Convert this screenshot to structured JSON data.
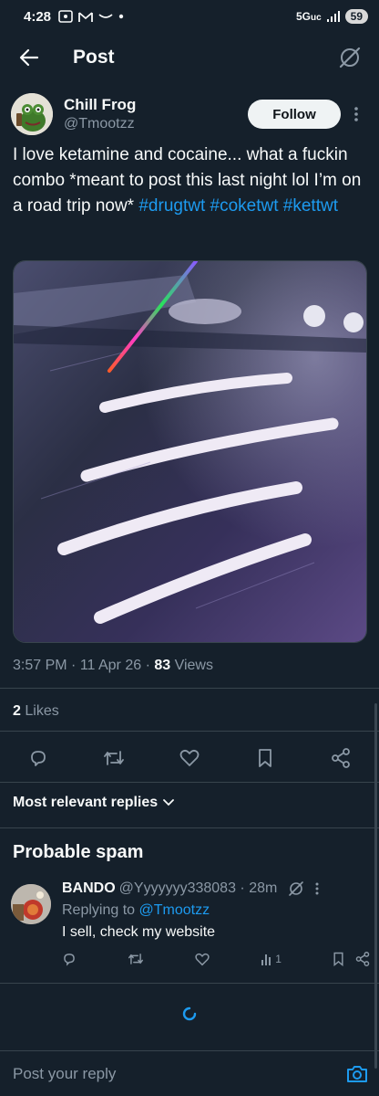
{
  "status_bar": {
    "time": "4:28",
    "network": "5G",
    "network_sub": "uc",
    "battery": "59"
  },
  "header": {
    "title": "Post"
  },
  "author": {
    "name": "Chill Frog",
    "handle": "@Tmootzz",
    "follow_label": "Follow"
  },
  "tweet": {
    "text": "I love ketamine and cocaine... what a fuckin combo *meant to post this last night lol I’m on a road trip now* ",
    "hashtags": [
      "#drugtwt",
      "#coketwt",
      "#kettwt"
    ],
    "time": "3:57 PM",
    "date": "11 Apr 26",
    "views_count": "83",
    "views_label": "Views",
    "likes_count": "2",
    "likes_label": "Likes"
  },
  "actions": {
    "icons": [
      "reply-icon",
      "repost-icon",
      "like-icon",
      "bookmark-icon",
      "share-icon"
    ]
  },
  "replies": {
    "sort_label": "Most relevant replies",
    "spam_heading": "Probable spam",
    "items": [
      {
        "name": "BANDO",
        "handle": "@Yyyyyyy338083",
        "age": "28m",
        "replying_prefix": "Replying to",
        "replying_to": "@Tmootzz",
        "text": "I sell, check my website",
        "views": "1"
      }
    ]
  },
  "compose": {
    "placeholder": "Post your reply"
  },
  "colors": {
    "background": "#15202b",
    "accent": "#1d9bf0",
    "muted": "#8b98a5",
    "divider": "#38444d"
  }
}
